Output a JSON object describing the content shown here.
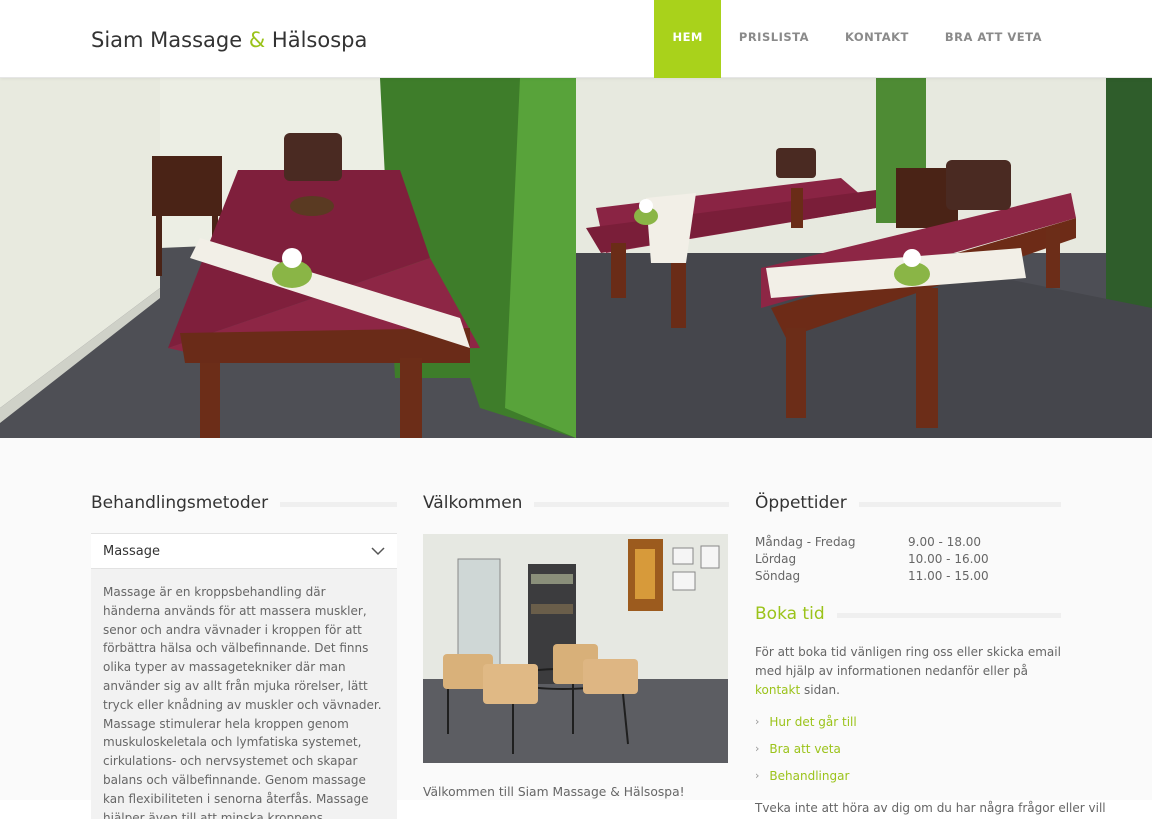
{
  "site": {
    "logo_part1": "Siam Massage",
    "logo_amp": "&",
    "logo_part2": "Hälsospa"
  },
  "nav": {
    "items": [
      {
        "label": "HEM",
        "active": true
      },
      {
        "label": "PRISLISTA",
        "active": false
      },
      {
        "label": "KONTAKT",
        "active": false
      },
      {
        "label": "BRA ATT VETA",
        "active": false
      }
    ]
  },
  "colors": {
    "accent": "#a9d21b",
    "accent_text": "#9bc31a"
  },
  "treatments": {
    "title": "Behandlingsmetoder",
    "accordion_label": "Massage",
    "accordion_icon": "chevron-down-icon",
    "body": "Massage är en kroppsbehandling där händerna används för att massera muskler, senor och andra vävnader i kroppen för att förbättra hälsa och välbefinnande. Det finns olika typer av massagetekniker där man använder sig av allt från mjuka rörelser, lätt tryck eller knådning av muskler och vävnader. Massage stimulerar hela kroppen genom muskuloskeletala och lymfatiska systemet, cirkulations- och nervsystemet och skapar balans och välbefinnande. Genom massage kan flexibiliteten i senorna återfås. Massage hjälper även till att minska kroppens spänningar och framkalla lugn."
  },
  "welcome": {
    "title": "Välkommen",
    "text": "Välkommen till Siam Massage & Hälsospa!"
  },
  "hours": {
    "title": "Öppettider",
    "rows": [
      {
        "day": "Måndag - Fredag",
        "time": "9.00 - 18.00"
      },
      {
        "day": "Lördag",
        "time": "10.00 - 16.00"
      },
      {
        "day": "Söndag",
        "time": "11.00 - 15.00"
      }
    ]
  },
  "booking": {
    "title": "Boka tid",
    "text_before": "För att boka tid vänligen ring oss eller skicka email med hjälp av informationen nedanför eller på ",
    "link": "kontakt",
    "text_after": " sidan.",
    "links": [
      "Hur det går till",
      "Bra att veta",
      "Behandlingar"
    ],
    "footer": "Tveka inte att höra av dig om du har några frågor eller vill"
  }
}
